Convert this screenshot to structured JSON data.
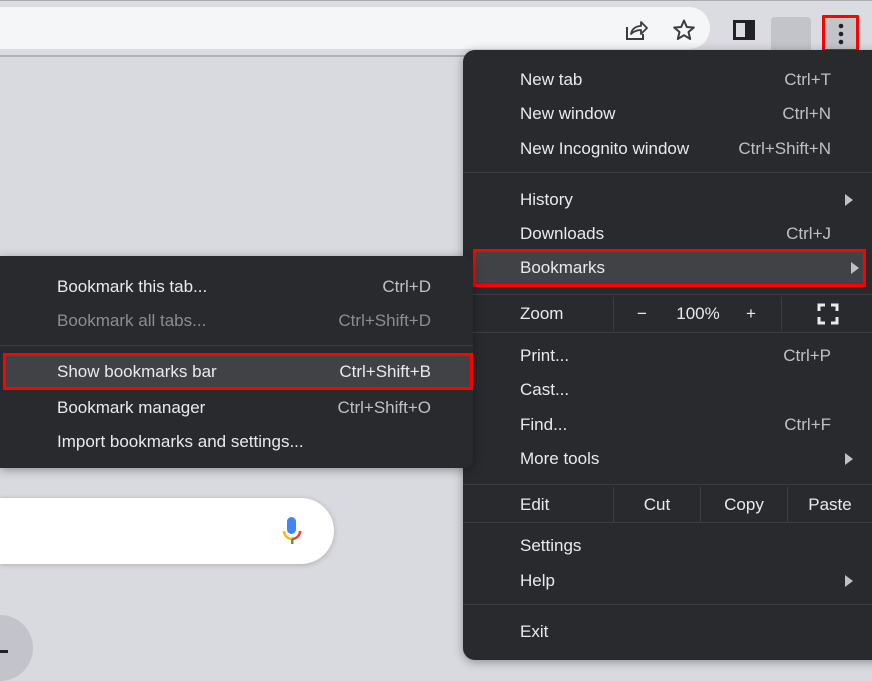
{
  "toolbar": {
    "icons": [
      "share-icon",
      "star-icon",
      "side-panel-icon",
      "profile-avatar",
      "kebab-menu-icon"
    ]
  },
  "main_menu": {
    "new_tab": {
      "label": "New tab",
      "shortcut": "Ctrl+T"
    },
    "new_window": {
      "label": "New window",
      "shortcut": "Ctrl+N"
    },
    "new_incognito": {
      "label": "New Incognito window",
      "shortcut": "Ctrl+Shift+N"
    },
    "history": {
      "label": "History"
    },
    "downloads": {
      "label": "Downloads",
      "shortcut": "Ctrl+J"
    },
    "bookmarks": {
      "label": "Bookmarks"
    },
    "zoom": {
      "label": "Zoom",
      "minus": "−",
      "value": "100%",
      "plus": "+"
    },
    "print": {
      "label": "Print...",
      "shortcut": "Ctrl+P"
    },
    "cast": {
      "label": "Cast..."
    },
    "find": {
      "label": "Find...",
      "shortcut": "Ctrl+F"
    },
    "more_tools": {
      "label": "More tools"
    },
    "edit": {
      "label": "Edit",
      "cut": "Cut",
      "copy": "Copy",
      "paste": "Paste"
    },
    "settings": {
      "label": "Settings"
    },
    "help": {
      "label": "Help"
    },
    "exit": {
      "label": "Exit"
    }
  },
  "bookmarks_menu": {
    "bookmark_tab": {
      "label": "Bookmark this tab...",
      "shortcut": "Ctrl+D"
    },
    "bookmark_all": {
      "label": "Bookmark all tabs...",
      "shortcut": "Ctrl+Shift+D"
    },
    "show_bar": {
      "label": "Show bookmarks bar",
      "shortcut": "Ctrl+Shift+B"
    },
    "manager": {
      "label": "Bookmark manager",
      "shortcut": "Ctrl+Shift+O"
    },
    "import": {
      "label": "Import bookmarks and settings..."
    }
  },
  "colors": {
    "highlight_border": "#ff0000",
    "menu_bg": "#292a2d",
    "page_bg": "#d9dadf"
  }
}
